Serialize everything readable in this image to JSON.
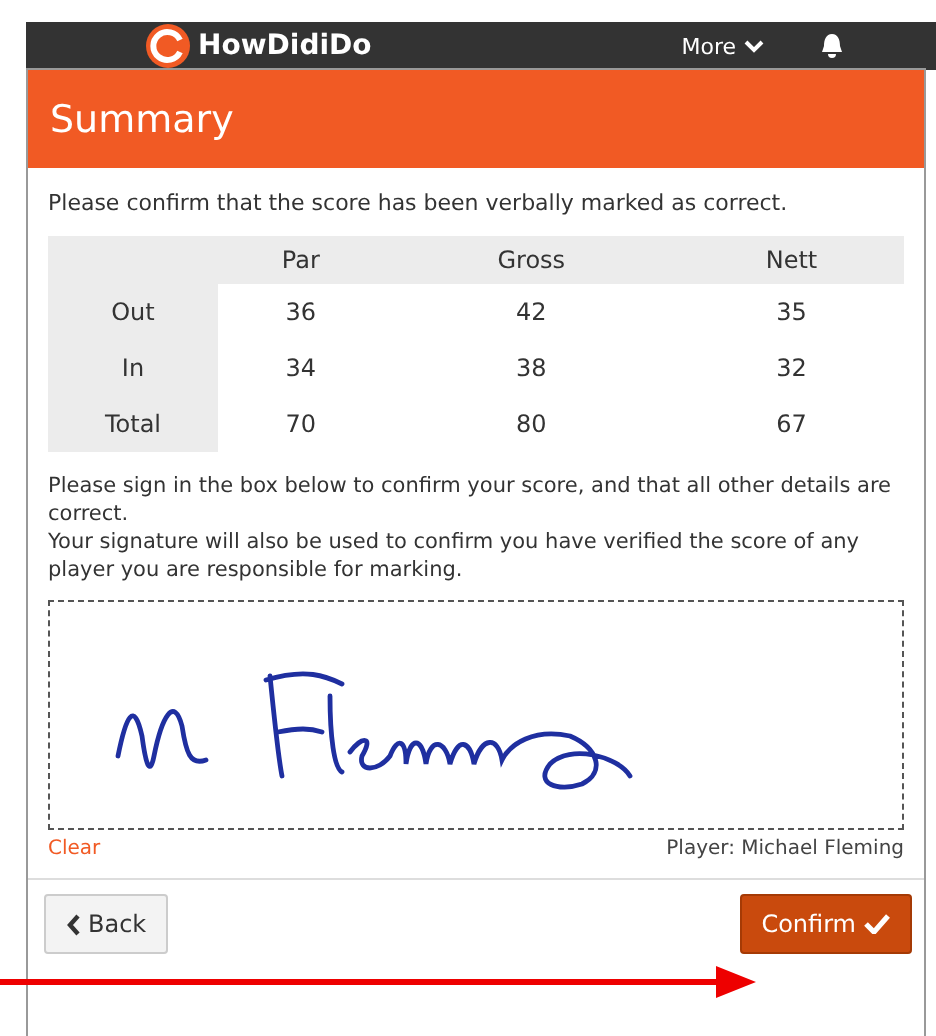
{
  "navbar": {
    "logo": "HowDidiDo",
    "more": "More"
  },
  "modal": {
    "title": "Summary",
    "intro": "Please confirm that the score has been verbally marked as correct.",
    "table": {
      "columns": [
        "Par",
        "Gross",
        "Nett"
      ],
      "rows": [
        {
          "label": "Out",
          "values": [
            "36",
            "42",
            "35"
          ]
        },
        {
          "label": "In",
          "values": [
            "34",
            "38",
            "32"
          ]
        },
        {
          "label": "Total",
          "values": [
            "70",
            "80",
            "67"
          ]
        }
      ]
    },
    "instructions": [
      "Please sign in the box below to confirm your score, and that all other details are correct.",
      "Your signature will also be used to confirm you have verified the score of any player you are responsible for marking."
    ],
    "clear": "Clear",
    "player": "Player: Michael Fleming",
    "buttons": [
      {
        "kind": "back",
        "label": "Back"
      },
      {
        "kind": "confirm",
        "label": "Confirm"
      }
    ]
  },
  "annotation": {
    "kind": "arrow"
  }
}
